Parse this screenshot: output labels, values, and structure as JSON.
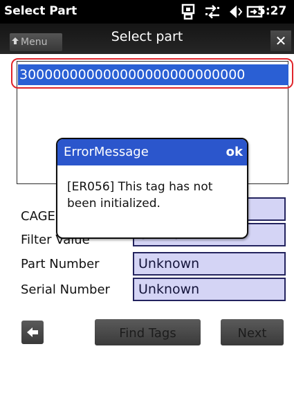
{
  "status_bar": {
    "title": "Select Part",
    "time": "5:27",
    "icons": [
      "phone-icon",
      "network-icon",
      "speaker-icon",
      "battery-icon"
    ]
  },
  "header": {
    "menu_label": "Menu",
    "title": "Select part",
    "close_label": "✕"
  },
  "tag_list": {
    "items": [
      "300000000000000000000000000"
    ]
  },
  "fields": [
    {
      "label": "CAGE",
      "value": ""
    },
    {
      "label": "Filter Value",
      "value": "Unknown"
    },
    {
      "label": "Part Number",
      "value": "Unknown"
    },
    {
      "label": "Serial Number",
      "value": "Unknown"
    }
  ],
  "buttons": {
    "find_tags": "Find Tags",
    "next": "Next"
  },
  "dialog": {
    "title": "ErrorMessage",
    "ok_label": "ok",
    "message": "[ER056] This tag has not been initialized."
  },
  "colors": {
    "accent": "#2b56cc",
    "field_bg": "#d4d4f5",
    "highlight": "#e0242a"
  }
}
